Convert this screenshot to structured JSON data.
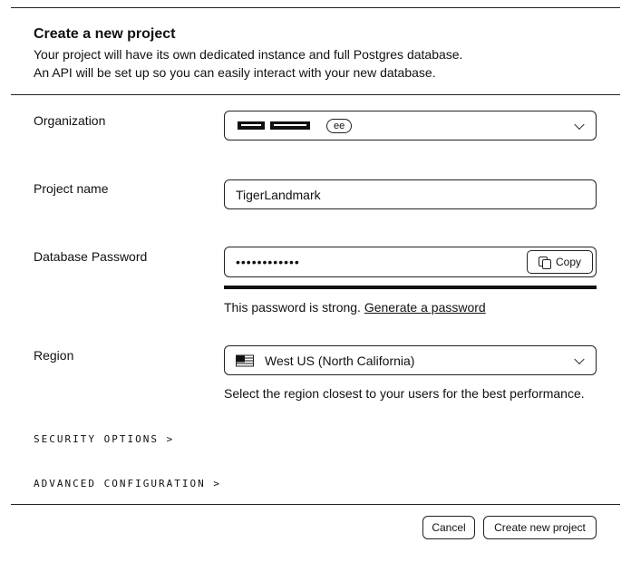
{
  "dialog": {
    "title": "Create a new project",
    "subtitle_line1": "Your project will have its own dedicated instance and full Postgres database.",
    "subtitle_line2": "An API will be set up so you can easily interact with your new database."
  },
  "organization": {
    "label": "Organization",
    "badge": "ee"
  },
  "project_name": {
    "label": "Project name",
    "value": "TigerLandmark"
  },
  "password": {
    "label": "Database Password",
    "masked_value": "••••••••••••",
    "copy_label": "Copy",
    "strength_text": "This password is strong.",
    "generate_link": "Generate a password",
    "strength_fraction": 1.0
  },
  "region": {
    "label": "Region",
    "value": "West US (North California)",
    "hint": "Select the region closest to your users for the best performance."
  },
  "sections": {
    "security": "SECURITY OPTIONS >",
    "advanced": "ADVANCED CONFIGURATION >"
  },
  "footer": {
    "cancel_label": "Cancel",
    "create_label": "Create new project"
  }
}
